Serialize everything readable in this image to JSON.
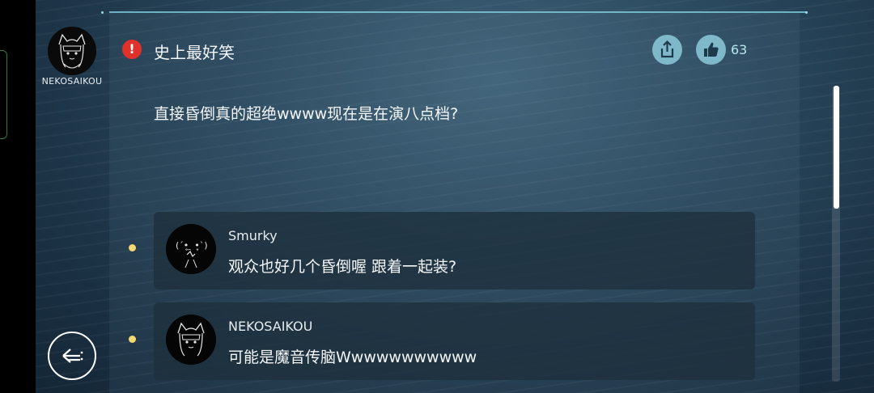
{
  "poster": {
    "name": "NEKOSAIKOU",
    "avatar_icon": "cat-girl-avatar-icon"
  },
  "post": {
    "alert_icon": "!",
    "alert_color": "#e0322b",
    "title": "史上最好笑",
    "body": "直接昏倒真的超绝wwww现在是在演八点档?"
  },
  "actions": {
    "share_icon": "share-icon",
    "like_icon": "thumbs-up-icon",
    "like_count": "63",
    "button_color": "#7fb8c8"
  },
  "replies": [
    {
      "name": "Smurky",
      "text": "观众也好几个昏倒喔 跟着一起装?",
      "avatar_icon": "shrug-face-avatar-icon",
      "marker_color": "#f3d971"
    },
    {
      "name": "NEKOSAIKOU",
      "text": "可能是魔音传脑Wwwwwwwwwww",
      "avatar_icon": "cat-girl-avatar-icon",
      "marker_color": "#f3d971"
    }
  ],
  "nav": {
    "back_icon": "back-arrow-icon"
  },
  "scroll": {
    "position_fraction": 0.0,
    "visible_fraction": 0.42
  }
}
